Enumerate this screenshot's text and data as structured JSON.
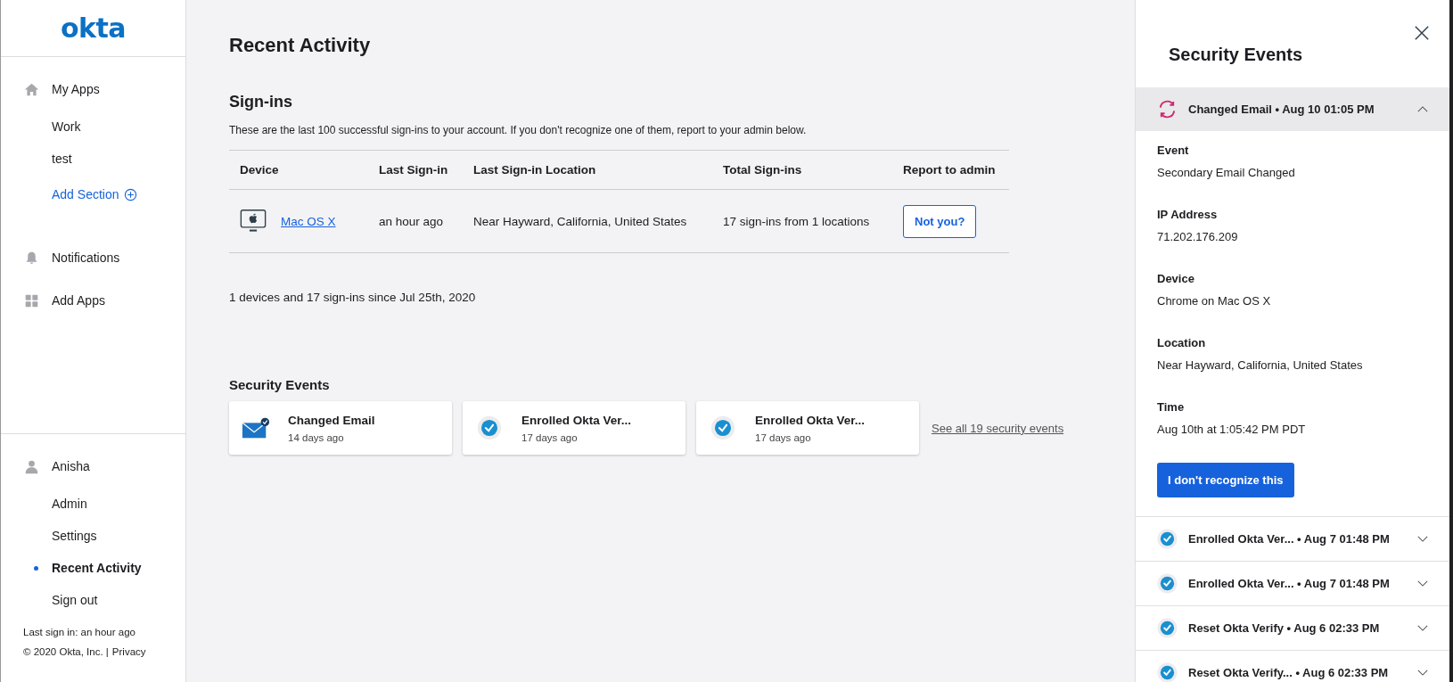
{
  "logo": "okta",
  "sidebar": {
    "top_items": [
      {
        "kind": "home",
        "label": "My Apps",
        "selected": false
      },
      {
        "kind": "sub",
        "label": "Work",
        "selected": false
      },
      {
        "kind": "sub",
        "label": "test",
        "selected": false
      },
      {
        "kind": "action",
        "label": "Add Section",
        "selected": false
      },
      {
        "kind": "gap"
      },
      {
        "kind": "bell",
        "label": "Notifications",
        "selected": false
      },
      {
        "kind": "grid",
        "label": "Add Apps",
        "selected": false
      }
    ],
    "bottom_items": [
      {
        "kind": "person",
        "label": "Anisha",
        "selected": false
      },
      {
        "kind": "sub",
        "label": "Admin",
        "selected": false
      },
      {
        "kind": "sub",
        "label": "Settings",
        "selected": false
      },
      {
        "kind": "sub",
        "label": "Recent Activity",
        "selected": true
      },
      {
        "kind": "sub",
        "label": "Sign out",
        "selected": false
      }
    ],
    "last_sign_in": "Last sign in: an hour ago",
    "copyright": "© 2020 Okta, Inc. |",
    "privacy_link": "Privacy"
  },
  "main": {
    "title": "Recent Activity",
    "signins": {
      "heading": "Sign-ins",
      "description": "These are the last 100 successful sign-ins to your account. If you don't recognize one of them, report to your admin below.",
      "columns": [
        "Device",
        "Last Sign-in",
        "Last Sign-in Location",
        "Total Sign-ins",
        "Report to admin"
      ],
      "rows": [
        {
          "device": "Mac OS X",
          "last_sign_in": "an hour ago",
          "location": "Near Hayward, California, United States",
          "total": "17 sign-ins from 1 locations",
          "action": "Not you?"
        }
      ],
      "summary": "1 devices and 17 sign-ins since Jul 25th, 2020"
    },
    "security_events": {
      "heading": "Security Events",
      "cards": [
        {
          "kind": "email",
          "title": "Changed Email",
          "time": "14 days ago"
        },
        {
          "kind": "verify",
          "title": "Enrolled Okta Ver...",
          "time": "17 days ago"
        },
        {
          "kind": "verify",
          "title": "Enrolled Okta Ver...",
          "time": "17 days ago"
        }
      ],
      "see_all": "See all 19 security events"
    }
  },
  "panel": {
    "title": "Security Events",
    "events": [
      {
        "kind": "sync",
        "label": "Changed Email • Aug 10 01:05 PM",
        "expanded": true,
        "details": [
          {
            "label": "Event",
            "value": "Secondary Email Changed"
          },
          {
            "label": "IP Address",
            "value": "71.202.176.209"
          },
          {
            "label": "Device",
            "value": "Chrome on Mac OS X"
          },
          {
            "label": "Location",
            "value": "Near Hayward, California, United States"
          },
          {
            "label": "Time",
            "value": "Aug 10th at 1:05:42 PM PDT"
          }
        ],
        "action": "I don't recognize this"
      },
      {
        "kind": "verify",
        "label": "Enrolled Okta Ver... • Aug 7 01:48 PM",
        "expanded": false
      },
      {
        "kind": "verify",
        "label": "Enrolled Okta Ver... • Aug 7 01:48 PM",
        "expanded": false
      },
      {
        "kind": "verify",
        "label": "Reset Okta Verify • Aug 6 02:33 PM",
        "expanded": false
      },
      {
        "kind": "verify",
        "label": "Reset Okta Verify... • Aug 6 02:33 PM",
        "expanded": false
      }
    ]
  }
}
